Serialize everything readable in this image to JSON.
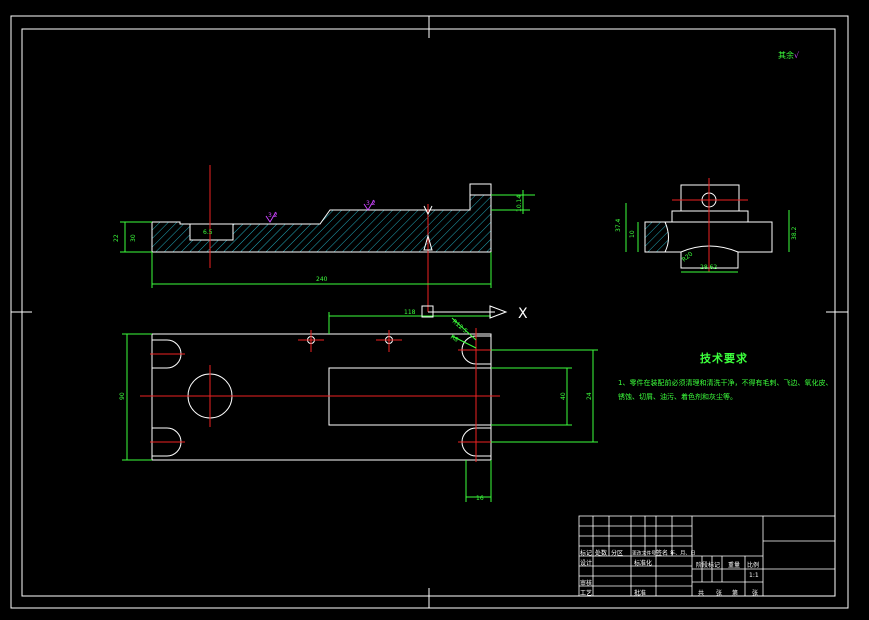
{
  "roughness_note": {
    "label": "其余",
    "value": "√"
  },
  "dimensions": {
    "overall_length": "240",
    "left_height": "22",
    "left_height2": "30",
    "right_step": "10",
    "right_step2": "10.14",
    "slot_dim": "6.5",
    "plan_offset": "118",
    "plan_width": "90",
    "plan_inner": "40",
    "plan_right": "24",
    "plan_bottom": "16",
    "radius_note1": "R12.5",
    "radius_note2": "R8",
    "side_h1": "37.4",
    "side_h2": "10",
    "side_h3": "38.2",
    "side_w": "28.62",
    "side_r": "R20",
    "rough1": "3.2",
    "rough2": "3.2"
  },
  "axis_marks": {
    "x": "X",
    "y": "Y"
  },
  "tech": {
    "title": "技术要求",
    "body": "1、零件在装配前必须清理和清洗干净，不得有毛刺、飞边、氧化皮、锈蚀、切屑、油污、着色剂和灰尘等。"
  },
  "title_block": {
    "row1": [
      "标记",
      "处数",
      "分区",
      "更改文件号",
      "签名",
      "年、月、日"
    ],
    "design": "设计",
    "standard": "标准化",
    "stage": "阶段标记",
    "weight": "重量",
    "scale_label": "比例",
    "scale": "1:1",
    "check": "审核",
    "process": "工艺",
    "approve": "批准",
    "sheets": "共",
    "sheet": "张",
    "sheet_no": "第",
    "sheet_of": "张"
  }
}
